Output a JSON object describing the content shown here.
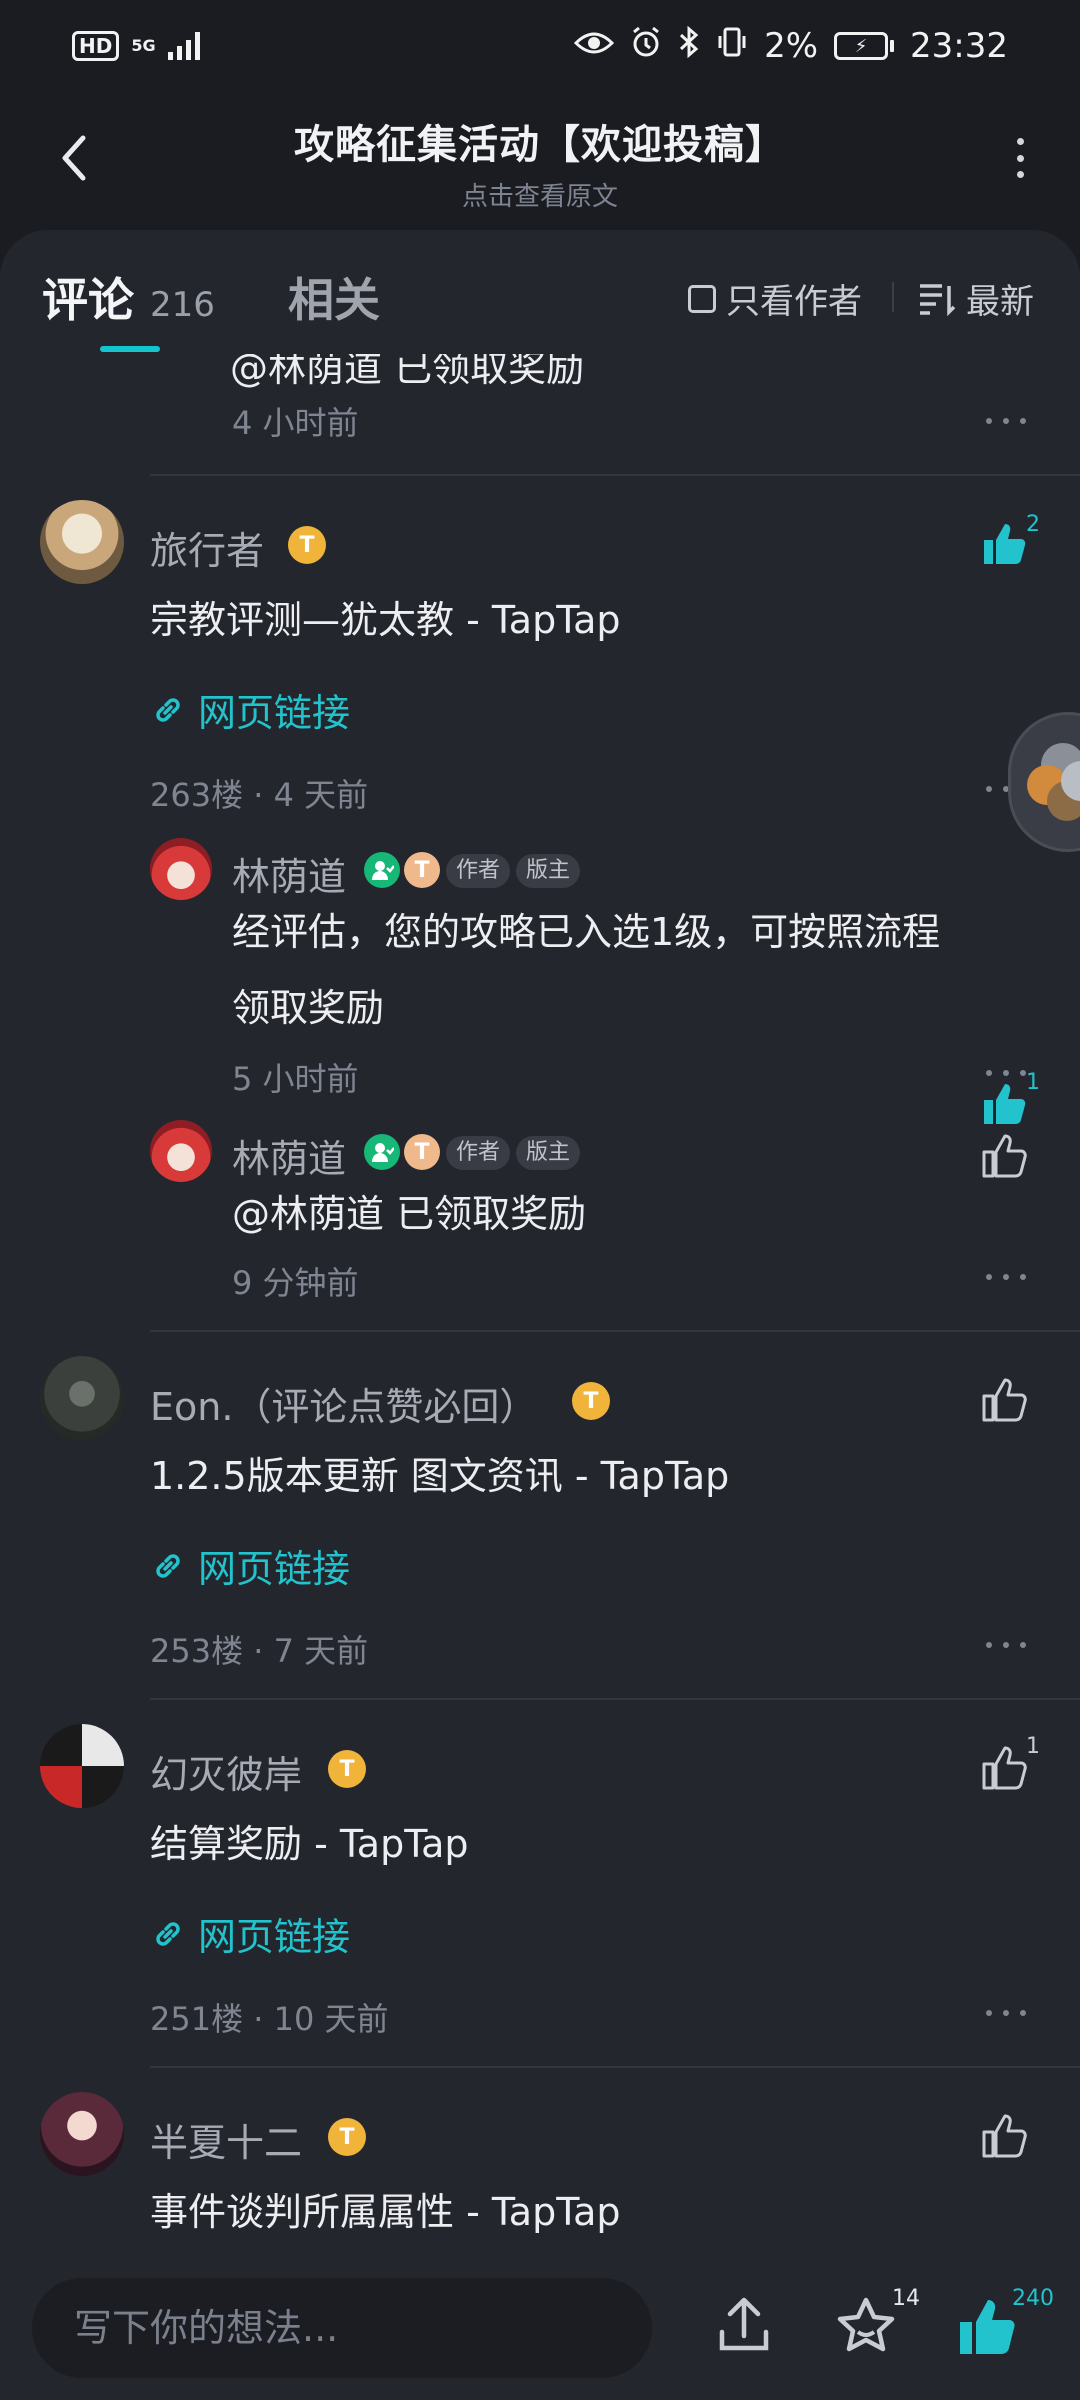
{
  "status_bar": {
    "hd": "HD",
    "network": "5G",
    "battery": "2%",
    "time": "23:32"
  },
  "header": {
    "title": "攻略征集活动【欢迎投稿】",
    "subtitle": "点击查看原文"
  },
  "tabs": {
    "comments_label": "评论",
    "comments_count": "216",
    "related_label": "相关"
  },
  "filters": {
    "author_only": "只看作者",
    "sort": "最新"
  },
  "top_partial": {
    "text": "@林荫道  已领取奖励",
    "time": "4 小时前"
  },
  "comments": [
    {
      "name": "旅行者",
      "badge": "T",
      "text": "宗教评测—犹太教 - TapTap",
      "link": "网页链接",
      "meta": "263楼 · 4 天前",
      "likes": "2",
      "replies": [
        {
          "name": "林荫道",
          "badge": "T",
          "tags": [
            "作者",
            "版主"
          ],
          "text_line1": "经评估，您的攻略已入选1级，可按照流程",
          "text_line2": "领取奖励",
          "time": "5 小时前",
          "likes": "1"
        },
        {
          "name": "林荫道",
          "badge": "T",
          "tags": [
            "作者",
            "版主"
          ],
          "text": "@林荫道  已领取奖励",
          "time": "9 分钟前"
        }
      ]
    },
    {
      "name": "Eon.（评论点赞必回）",
      "badge": "T",
      "text": "1.2.5版本更新 图文资讯 - TapTap",
      "link": "网页链接",
      "meta": "253楼 · 7 天前"
    },
    {
      "name": "幻灭彼岸",
      "badge": "T",
      "text": "结算奖励 - TapTap",
      "link": "网页链接",
      "meta": "251楼 · 10 天前",
      "likes": "1"
    },
    {
      "name": "半夏十二",
      "badge": "T",
      "text": "事件谈判所属属性 - TapTap"
    }
  ],
  "bottom_bar": {
    "placeholder": "写下你的想法...",
    "star_count": "14",
    "like_count": "240"
  },
  "colors": {
    "accent": "#22c3cc",
    "background": "#24262d",
    "header_bg": "#1a1c21"
  }
}
